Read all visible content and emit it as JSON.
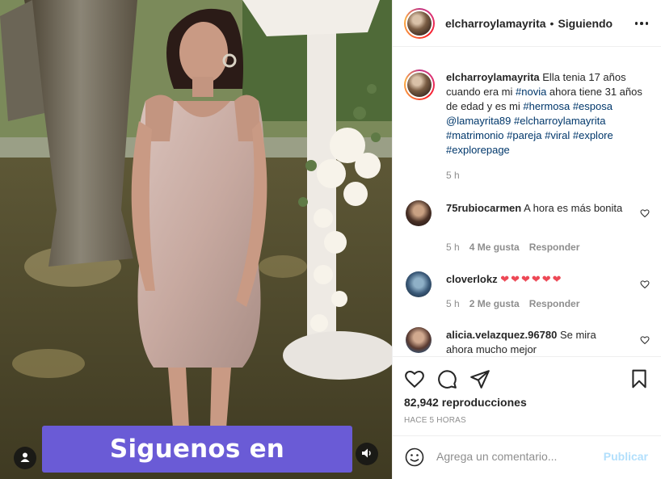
{
  "post": {
    "username": "elcharroylamayrita",
    "follow_state": "Siguiendo",
    "separator": "•",
    "more_icon": "more-horizontal-icon"
  },
  "media": {
    "caption_overlay": "Siguenos en instagram",
    "user_tag_icon": "user-tag-icon",
    "audio_icon": "speaker-icon"
  },
  "caption": {
    "username": "elcharroylamayrita",
    "text_1": "Ella tenia 17 años cuando era mi ",
    "tag_novia": "#novia",
    "text_2": " ahora tiene 31 años de edad y es mi ",
    "tag_hermosa": "#hermosa",
    "tag_esposa": "#esposa",
    "mention": "@lamayrita89",
    "tag_charro": "#elcharroylamayrita",
    "tag_matrimonio": "#matrimonio",
    "tag_pareja": "#pareja",
    "tag_viral": "#viral",
    "tag_explore": "#explore",
    "tag_explorepage": "#explorepage",
    "time": "5 h"
  },
  "comments": [
    {
      "username": "75rubiocarmen",
      "text": "A hora es más bonita",
      "time": "5 h",
      "likes": "4 Me gusta",
      "reply": "Responder"
    },
    {
      "username": "cloverlokz",
      "text": "❤❤❤❤❤❤",
      "time": "5 h",
      "likes": "2 Me gusta",
      "reply": "Responder"
    },
    {
      "username": "alicia.velazquez.96780",
      "text": "Se mira ahora mucho mejor"
    }
  ],
  "stats": {
    "views": "82,942 reproducciones",
    "posted": "HACE 5 HORAS"
  },
  "composer": {
    "placeholder": "Agrega un comentario...",
    "publish_label": "Publicar"
  },
  "colors": {
    "link": "#00376b",
    "muted": "#8e8e8e",
    "publish_disabled": "#b2dffc",
    "overlay_banner": "#6a5bd6",
    "heart_red": "#ed4956"
  }
}
